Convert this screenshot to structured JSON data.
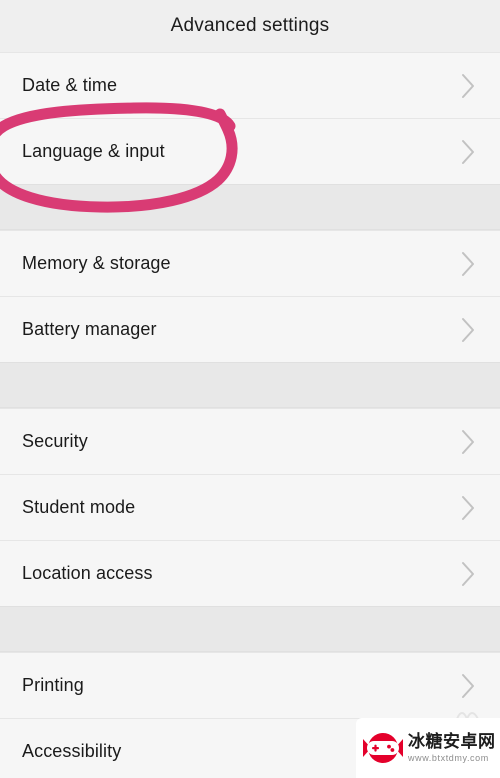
{
  "header": {
    "title": "Advanced settings"
  },
  "colors": {
    "background": "#f6f6f6",
    "header_background": "#efefef",
    "section_gap": "#e8e8e8",
    "divider": "#e6e6e6",
    "text": "#1b1b1b",
    "chevron": "#c2c2c2",
    "annotation_pink": "#d93b74",
    "watermark_red": "#e4002b"
  },
  "icons": {
    "chevron": "chevron-right-icon",
    "annotation": "pink-circle-annotation"
  },
  "sections": [
    {
      "items": [
        {
          "label": "Date & time"
        },
        {
          "label": "Language & input",
          "highlighted": true
        }
      ]
    },
    {
      "items": [
        {
          "label": "Memory & storage"
        },
        {
          "label": "Battery manager"
        }
      ]
    },
    {
      "items": [
        {
          "label": "Security"
        },
        {
          "label": "Student mode"
        },
        {
          "label": "Location access"
        }
      ]
    },
    {
      "items": [
        {
          "label": "Printing"
        },
        {
          "label": "Accessibility"
        }
      ]
    }
  ],
  "watermark": {
    "brand_cn": "冰糖安卓网",
    "url": "www.btxtdmy.com"
  }
}
